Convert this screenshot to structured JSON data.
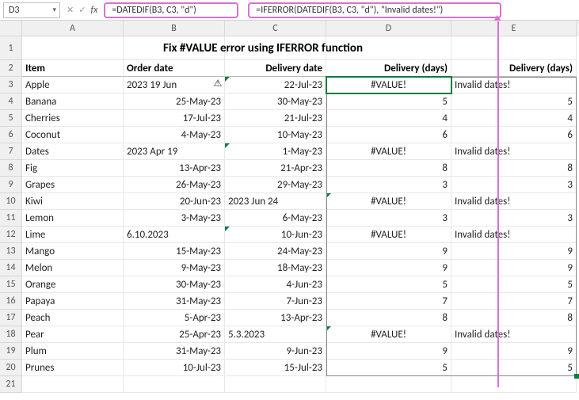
{
  "nameBox": "D3",
  "formulaD": "=DATEDIF(B3, C3, \"d\")",
  "formulaE": "=IFERROR(DATEDIF(B3, C3, \"d\"), \"Invalid dates!\")",
  "title": "Fix #VALUE error using IFERROR function",
  "cols": {
    "A": "A",
    "B": "B",
    "C": "C",
    "D": "D",
    "E": "E"
  },
  "headers": {
    "item": "Item",
    "order": "Order date",
    "delivery": "Delivery date",
    "d": "Delivery (days)",
    "e": "Delivery (days)"
  },
  "rows": [
    {
      "n": 3,
      "item": "Apple",
      "order": "2023 19 Jun",
      "orderL": true,
      "deliv": "22-Jul-23",
      "gtC": true,
      "warn": true,
      "d": "#VALUE!",
      "dC": true,
      "e": "Invalid dates!",
      "eL": true
    },
    {
      "n": 4,
      "item": "Banana",
      "order": "25-May-23",
      "deliv": "30-May-23",
      "d": "5",
      "e": "5"
    },
    {
      "n": 5,
      "item": "Cherries",
      "order": "17-Jul-23",
      "deliv": "21-Jul-23",
      "d": "4",
      "e": "4"
    },
    {
      "n": 6,
      "item": "Coconut",
      "order": "4-May-23",
      "deliv": "10-May-23",
      "d": "6",
      "e": "6"
    },
    {
      "n": 7,
      "item": "Dates",
      "order": "2023 Apr 19",
      "orderL": true,
      "deliv": "1-May-23",
      "gtC": true,
      "d": "#VALUE!",
      "dC": true,
      "e": "Invalid dates!",
      "eL": true
    },
    {
      "n": 8,
      "item": "Fig",
      "order": "13-Apr-23",
      "deliv": "21-Apr-23",
      "d": "8",
      "e": "8"
    },
    {
      "n": 9,
      "item": "Grapes",
      "order": "26-May-23",
      "deliv": "29-May-23",
      "d": "3",
      "e": "3"
    },
    {
      "n": 10,
      "item": "Kiwi",
      "order": "20-Jun-23",
      "deliv": "2023 Jun 24",
      "delivL": true,
      "gtD": true,
      "d": "#VALUE!",
      "dC": true,
      "e": "Invalid dates!",
      "eL": true
    },
    {
      "n": 11,
      "item": "Lemon",
      "order": "3-May-23",
      "deliv": "6-May-23",
      "d": "3",
      "e": "3"
    },
    {
      "n": 12,
      "item": "Lime",
      "order": "6.10.2023",
      "orderL": true,
      "deliv": "10-Jun-23",
      "gtC": true,
      "d": "#VALUE!",
      "dC": true,
      "e": "Invalid dates!",
      "eL": true
    },
    {
      "n": 13,
      "item": "Mango",
      "order": "15-May-23",
      "deliv": "24-May-23",
      "d": "9",
      "e": "9"
    },
    {
      "n": 14,
      "item": "Melon",
      "order": "9-May-23",
      "deliv": "18-May-23",
      "d": "9",
      "e": "9"
    },
    {
      "n": 15,
      "item": "Orange",
      "order": "30-May-23",
      "deliv": "4-Jun-23",
      "d": "5",
      "e": "5"
    },
    {
      "n": 16,
      "item": "Papaya",
      "order": "31-May-23",
      "deliv": "7-Jun-23",
      "d": "7",
      "e": "7"
    },
    {
      "n": 17,
      "item": "Peach",
      "order": "5-Apr-23",
      "deliv": "13-Apr-23",
      "d": "8",
      "e": "8"
    },
    {
      "n": 18,
      "item": "Pear",
      "order": "25-Apr-23",
      "deliv": "5.3.2023",
      "delivL": true,
      "gtD": true,
      "d": "#VALUE!",
      "dC": true,
      "e": "Invalid dates!",
      "eL": true
    },
    {
      "n": 19,
      "item": "Plum",
      "order": "31-May-23",
      "deliv": "9-Jun-23",
      "d": "9",
      "e": "9"
    },
    {
      "n": 20,
      "item": "Prunes",
      "order": "10-Jul-23",
      "deliv": "15-Jul-23",
      "d": "5",
      "e": "5"
    },
    {
      "n": 21,
      "item": "",
      "order": "",
      "deliv": "",
      "d": "",
      "e": ""
    }
  ]
}
